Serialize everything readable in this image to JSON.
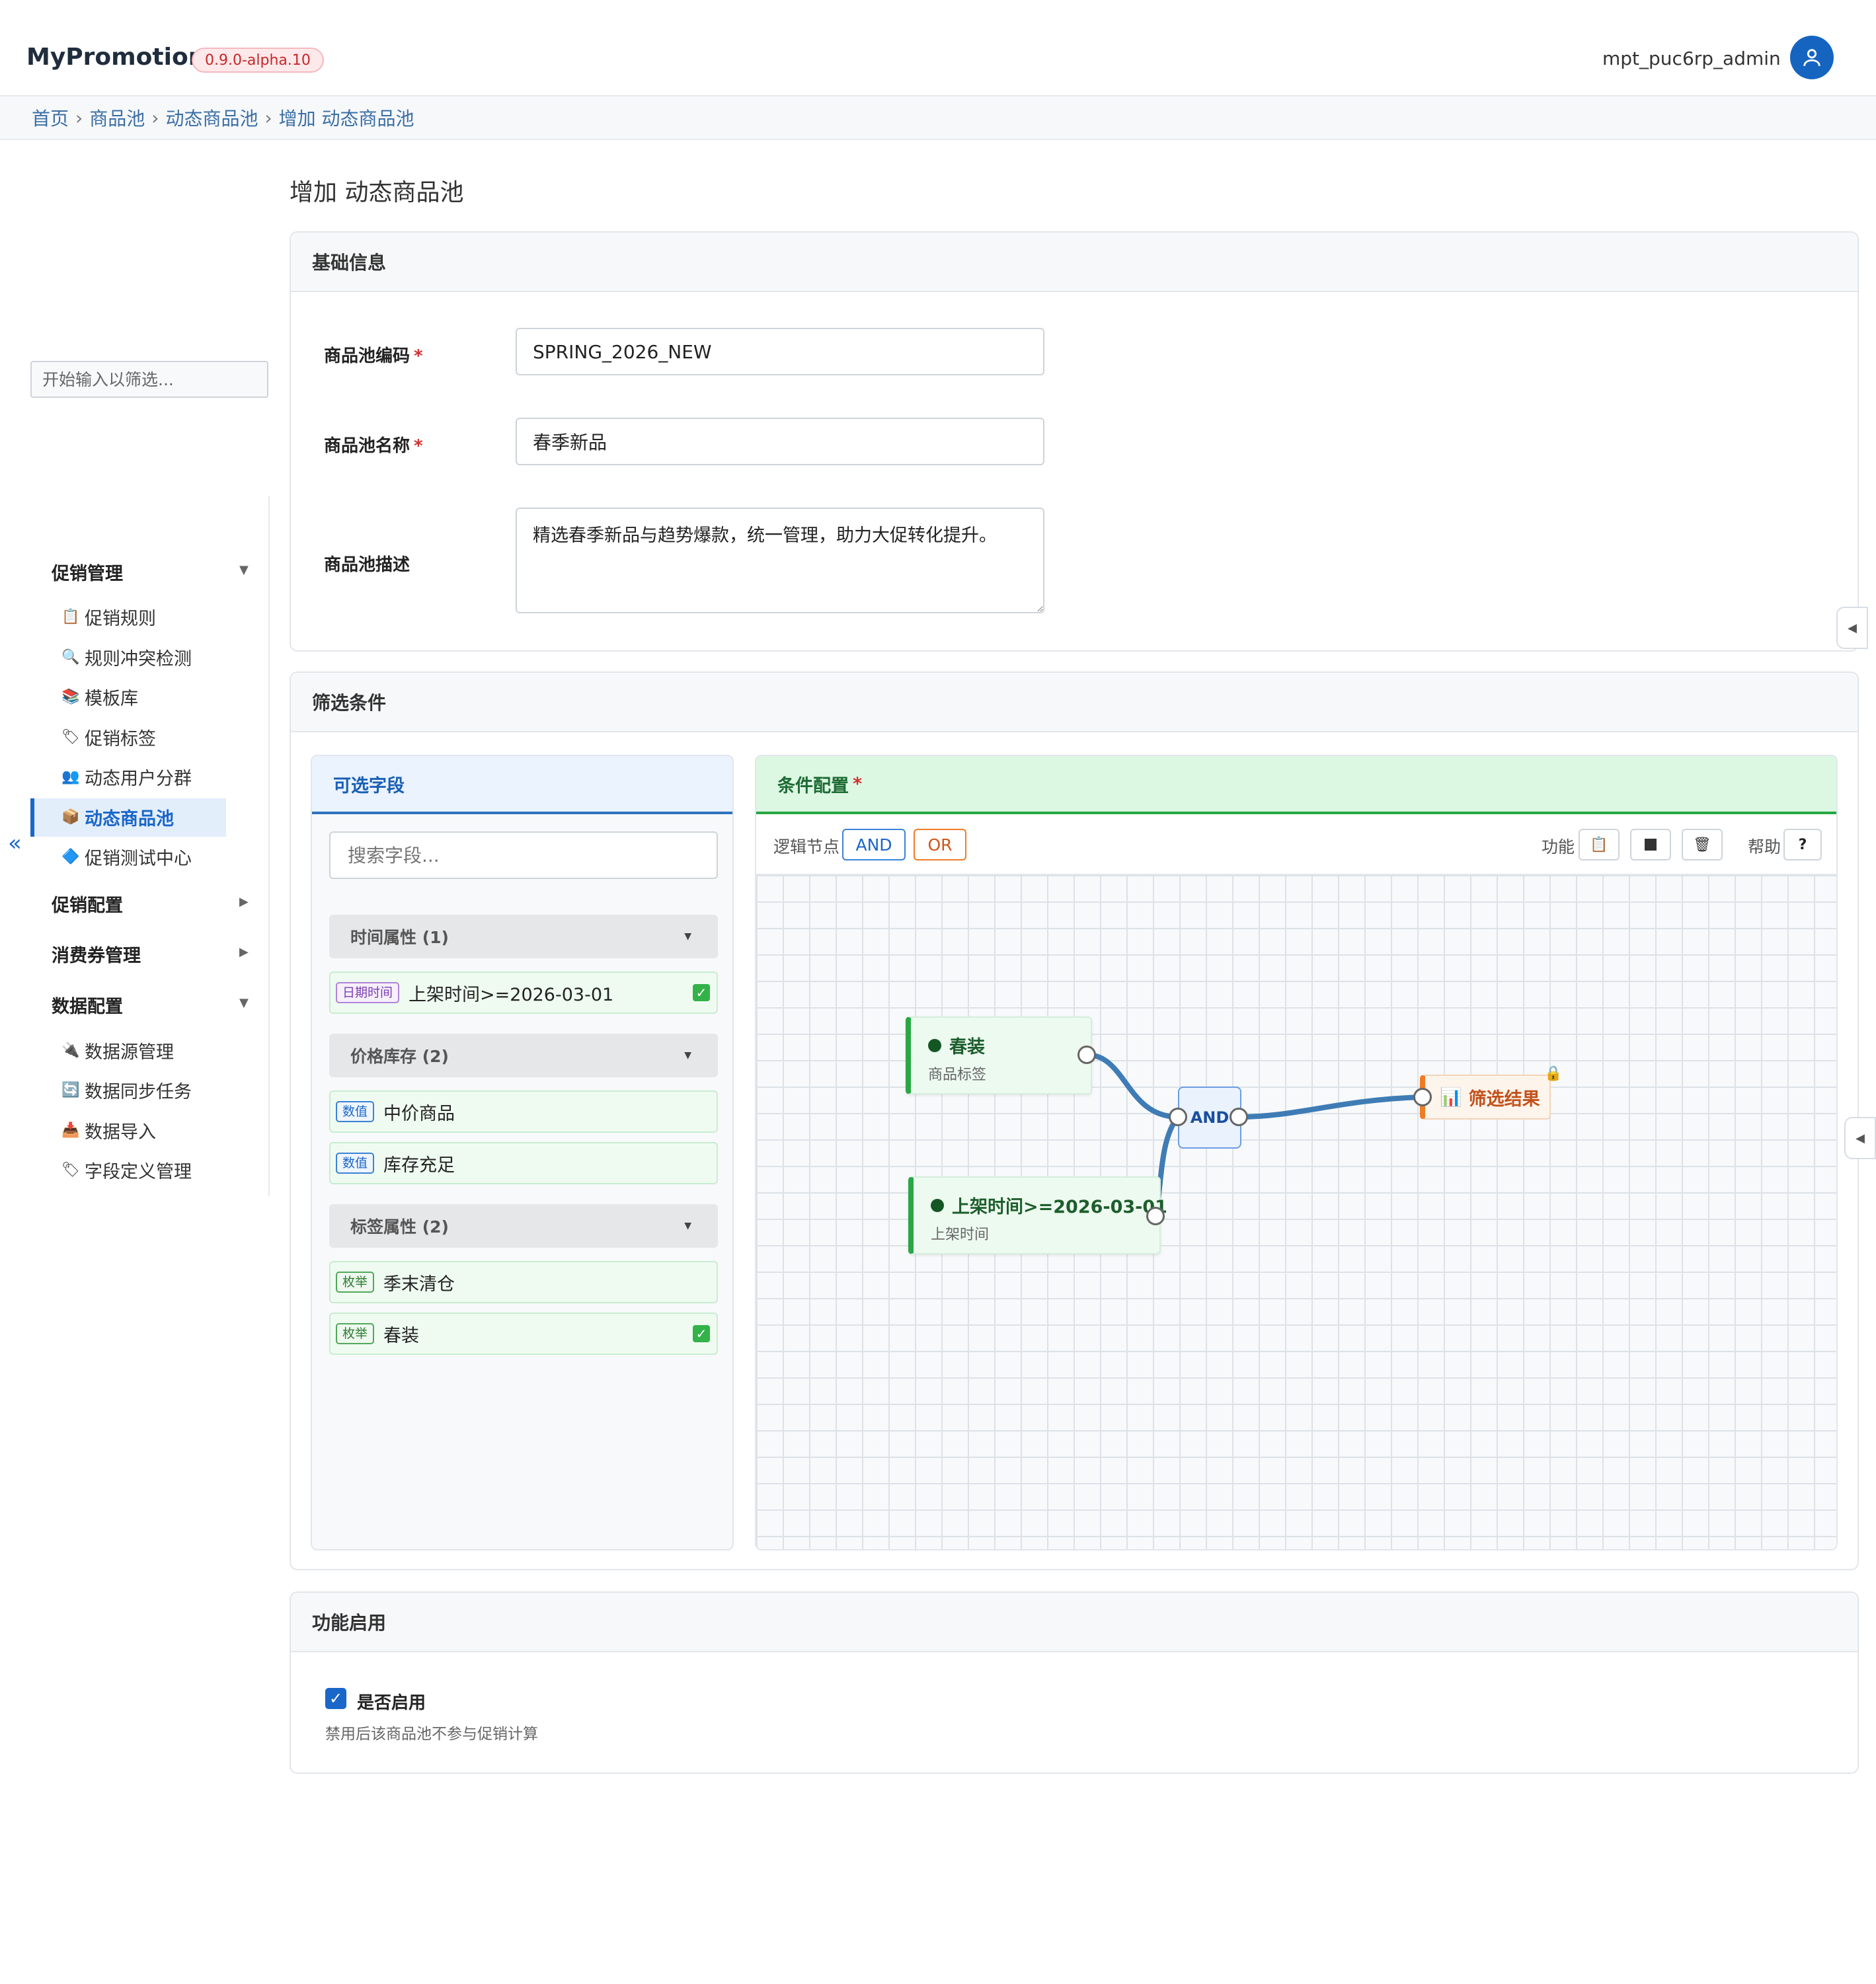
{
  "header": {
    "app_title": "MyPromotion",
    "version": "0.9.0-alpha.10",
    "username": "mpt_puc6rp_admin"
  },
  "breadcrumb": [
    "首页",
    "商品池",
    "动态商品池",
    "增加 动态商品池"
  ],
  "sidebar": {
    "filter_placeholder": "开始输入以筛选...",
    "groups": [
      {
        "label": "促销管理",
        "expanded": true,
        "items": [
          {
            "icon": "clipboard-icon",
            "label": "促销规则"
          },
          {
            "icon": "magnifier-icon",
            "label": "规则冲突检测"
          },
          {
            "icon": "books-icon",
            "label": "模板库"
          },
          {
            "icon": "tag-icon",
            "label": "促销标签"
          },
          {
            "icon": "users-icon",
            "label": "动态用户分群"
          },
          {
            "icon": "package-icon",
            "label": "动态商品池",
            "active": true
          },
          {
            "icon": "diamond-icon",
            "label": "促销测试中心"
          }
        ]
      },
      {
        "label": "促销配置",
        "expanded": false
      },
      {
        "label": "消费券管理",
        "expanded": false
      },
      {
        "label": "数据配置",
        "expanded": true,
        "items": [
          {
            "icon": "plug-icon",
            "label": "数据源管理"
          },
          {
            "icon": "sync-icon",
            "label": "数据同步任务"
          },
          {
            "icon": "inbox-icon",
            "label": "数据导入"
          },
          {
            "icon": "tag-icon",
            "label": "字段定义管理"
          }
        ]
      }
    ]
  },
  "page_title": "增加 动态商品池",
  "basic_info": {
    "title": "基础信息",
    "code_label": "商品池编码",
    "code_value": "SPRING_2026_NEW",
    "name_label": "商品池名称",
    "name_value": "春季新品",
    "desc_label": "商品池描述",
    "desc_value": "精选春季新品与趋势爆款，统一管理，助力大促转化提升。"
  },
  "filter": {
    "title": "筛选条件",
    "fields_panel": {
      "title": "可选字段",
      "search_placeholder": "搜索字段...",
      "groups": [
        {
          "label": "时间属性 (1)",
          "items": [
            {
              "tag": "日期时间",
              "label": "上架时间>=2026-03-01",
              "checked": true
            }
          ]
        },
        {
          "label": "价格库存 (2)",
          "items": [
            {
              "tag": "数值",
              "label": "中价商品",
              "checked": false
            },
            {
              "tag": "数值",
              "label": "库存充足",
              "checked": false
            }
          ]
        },
        {
          "label": "标签属性 (2)",
          "items": [
            {
              "tag": "枚举",
              "label": "季末清仓",
              "checked": false
            },
            {
              "tag": "枚举",
              "label": "春装",
              "checked": true
            }
          ]
        }
      ]
    },
    "condition_panel": {
      "title": "条件配置",
      "logic_label": "逻辑节点",
      "and_label": "AND",
      "or_label": "OR",
      "func_label": "功能",
      "help_label": "帮助",
      "help_button": "?",
      "nodes": {
        "n1_title": "春装",
        "n1_sub": "商品标签",
        "n2_title": "上架时间>=2026-03-01",
        "n2_sub": "上架时间",
        "logic": "AND",
        "result": "筛选结果"
      }
    }
  },
  "enable": {
    "title": "功能启用",
    "checkbox_label": "是否启用",
    "checked": true,
    "hint": "禁用后该商品池不参与促销计算"
  },
  "colors": {
    "primary": "#1a66c9",
    "accent_green": "#28a745",
    "accent_orange": "#ef7c27",
    "edge": "#3f7cb5"
  }
}
